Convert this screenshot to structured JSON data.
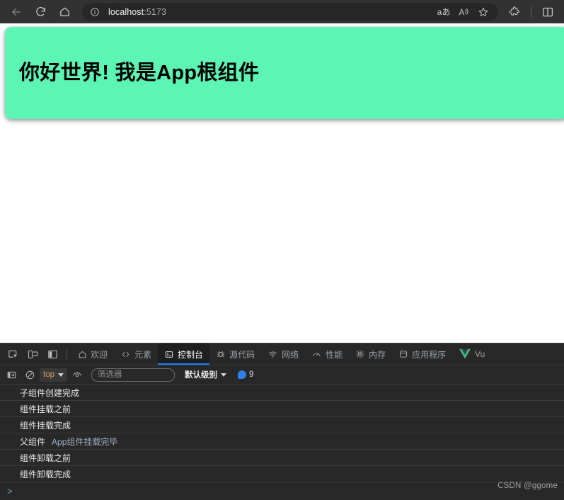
{
  "browser": {
    "nav": {
      "back_icon": "arrow-left-icon",
      "reload_icon": "reload-icon",
      "home_icon": "home-icon"
    },
    "address": {
      "info_icon": "info-circle-icon",
      "host": "localhost",
      "port": ":5173",
      "full_url": "localhost:5173",
      "translate_icon": "translate-icon",
      "translate_label": "aあ",
      "read_aloud_icon": "read-aloud-icon",
      "favorite_icon": "star-icon"
    },
    "toolbar": {
      "extensions_icon": "puzzle-piece-icon",
      "split_screen_icon": "split-screen-icon"
    }
  },
  "page": {
    "banner_heading": "你好世界! 我是App根组件",
    "banner_color": "#5cf5b4",
    "background_color": "#ffffff"
  },
  "devtools": {
    "tools": [
      {
        "name": "inspect-element-icon"
      },
      {
        "name": "device-toolbar-icon"
      },
      {
        "name": "dock-panel-icon"
      }
    ],
    "tabs": [
      {
        "label": "欢迎",
        "icon": "home-icon",
        "active": false
      },
      {
        "label": "元素",
        "icon": "code-brackets-icon",
        "active": false
      },
      {
        "label": "控制台",
        "icon": "console-terminal-icon",
        "active": true
      },
      {
        "label": "源代码",
        "icon": "bug-icon",
        "active": false
      },
      {
        "label": "网络",
        "icon": "wifi-icon",
        "active": false
      },
      {
        "label": "性能",
        "icon": "gauge-icon",
        "active": false
      },
      {
        "label": "内存",
        "icon": "chip-icon",
        "active": false
      },
      {
        "label": "应用程序",
        "icon": "database-icon",
        "active": false
      },
      {
        "label": "Vu",
        "icon": "vue-logo-icon",
        "active": false
      }
    ],
    "active_tab_indicator_color": "#0b83ff",
    "console": {
      "toolbar": {
        "sidebar_icon": "console-sidebar-icon",
        "clear_icon": "clear-console-icon",
        "context_value": "top",
        "live_expression_icon": "eye-icon",
        "filter_placeholder": "筛选器",
        "filter_value": "",
        "level_label": "默认级别",
        "info_count": "9",
        "info_icon": "info-bubble-icon"
      },
      "messages": [
        {
          "text": "子组件创建完成",
          "arg2": ""
        },
        {
          "text": "组件挂载之前",
          "arg2": ""
        },
        {
          "text": "组件挂载完成",
          "arg2": ""
        },
        {
          "text": "父组件",
          "arg2": "App组件挂载完毕"
        },
        {
          "text": "组件卸载之前",
          "arg2": ""
        },
        {
          "text": "组件卸载完成",
          "arg2": ""
        }
      ],
      "prompt_symbol": ">"
    }
  },
  "watermark": "CSDN @ggome"
}
